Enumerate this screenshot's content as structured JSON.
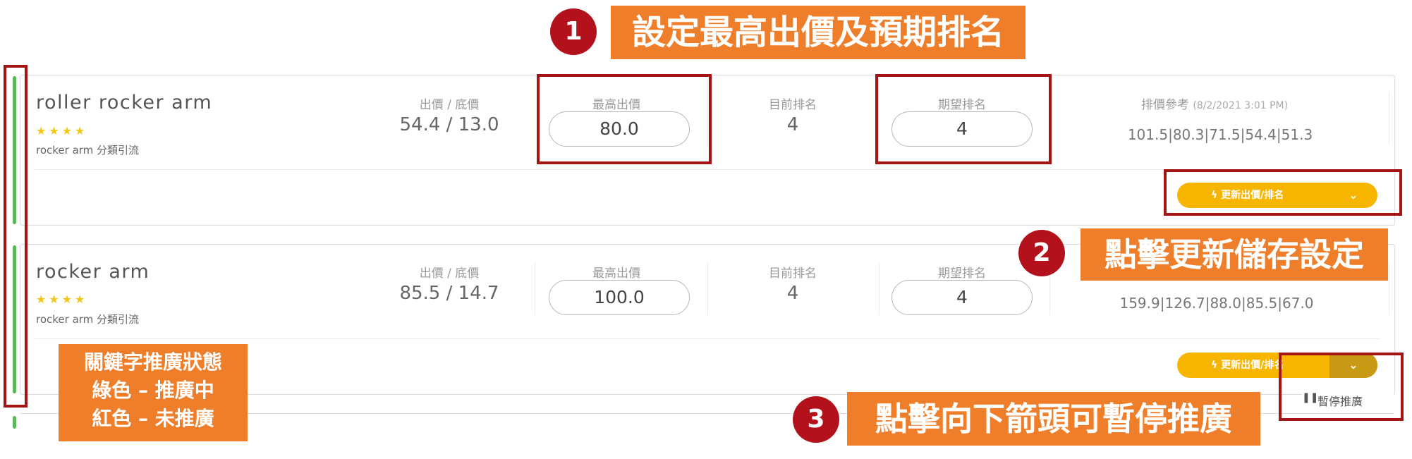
{
  "annotations": {
    "step1": {
      "number": "1",
      "text": "設定最高出價及預期排名"
    },
    "step2": {
      "number": "2",
      "text": "點擊更新儲存設定"
    },
    "step3": {
      "number": "3",
      "text": "點擊向下箭頭可暫停推廣"
    },
    "status_legend": {
      "line1": "關鍵字推廣狀態",
      "line2": "綠色 – 推廣中",
      "line3": "紅色 – 未推廣"
    }
  },
  "columns": {
    "bid_floor": "出價 / 底價",
    "max_bid": "最高出價",
    "current_rank": "目前排名",
    "expected_rank": "期望排名",
    "bid_reference": "排價參考",
    "bid_reference_time": "(8/2/2021 3:01 PM)"
  },
  "keywords": [
    {
      "title": "roller rocker arm",
      "stars": "★★★★",
      "subtitle": "rocker arm 分類引流",
      "bid_floor": "54.4 / 13.0",
      "max_bid": "80.0",
      "current_rank": "4",
      "expected_rank": "4",
      "reference": "101.5|80.3|71.5|54.4|51.3",
      "status": "active",
      "update_label": "更新出價/排名"
    },
    {
      "title": "rocker arm",
      "stars": "★★★★",
      "subtitle": "rocker arm 分類引流",
      "bid_floor": "85.5 / 14.7",
      "max_bid": "100.0",
      "current_rank": "4",
      "expected_rank": "4",
      "reference": "159.9|126.7|88.0|85.5|67.0",
      "status": "active",
      "update_label": "更新出價/排名"
    }
  ],
  "dropdown_menu": {
    "pause_label": "暫停推廣",
    "pause_icon": "pause-icon"
  },
  "colors": {
    "active_status": "#5cb85c",
    "update_button": "#f7b500",
    "annotation_red": "#a31515",
    "annotation_orange": "#ef7e2a"
  }
}
